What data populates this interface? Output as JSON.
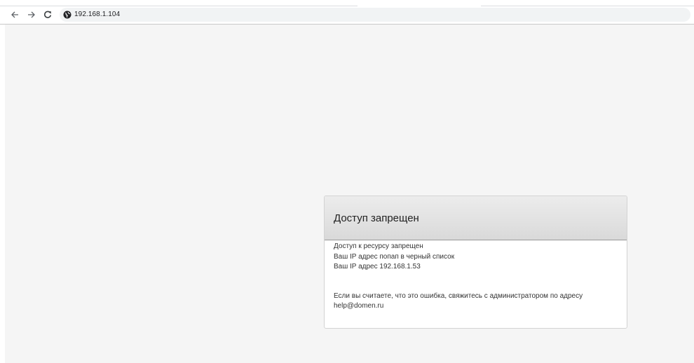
{
  "browser": {
    "url": "192.168.1.104",
    "icons": {
      "back": "arrow-left-icon",
      "forward": "arrow-right-icon",
      "reload": "reload-icon",
      "site_info": "globe-icon"
    }
  },
  "page": {
    "background": "#f5f5f5",
    "panel": {
      "title": "Доступ запрещен",
      "lines": [
        "Доступ к ресурсу запрещен",
        "Ваш IP адрес попап в черный список",
        "Ваш IP адрес 192.168.1.53"
      ],
      "contact_line": "Если вы считаете, что это ошибка, свяжитесь с администратором по адресу",
      "contact_email": "help@domen.ru"
    }
  }
}
